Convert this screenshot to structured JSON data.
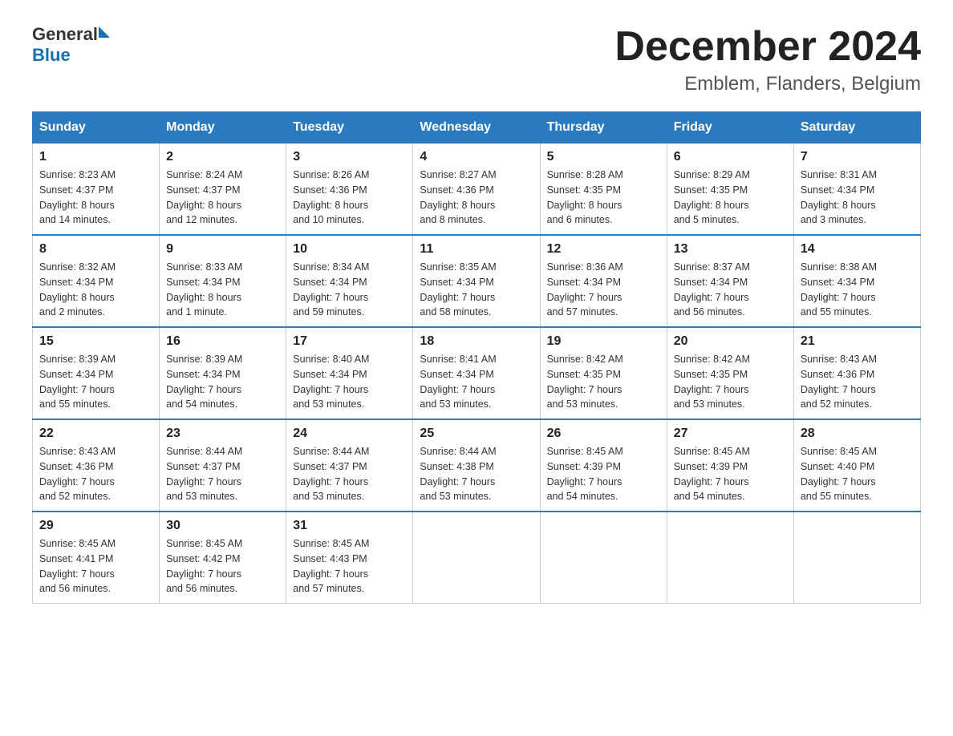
{
  "header": {
    "logo_text1": "General",
    "logo_text2": "Blue",
    "month_title": "December 2024",
    "location": "Emblem, Flanders, Belgium"
  },
  "days_of_week": [
    "Sunday",
    "Monday",
    "Tuesday",
    "Wednesday",
    "Thursday",
    "Friday",
    "Saturday"
  ],
  "weeks": [
    [
      {
        "day": "1",
        "info": "Sunrise: 8:23 AM\nSunset: 4:37 PM\nDaylight: 8 hours\nand 14 minutes."
      },
      {
        "day": "2",
        "info": "Sunrise: 8:24 AM\nSunset: 4:37 PM\nDaylight: 8 hours\nand 12 minutes."
      },
      {
        "day": "3",
        "info": "Sunrise: 8:26 AM\nSunset: 4:36 PM\nDaylight: 8 hours\nand 10 minutes."
      },
      {
        "day": "4",
        "info": "Sunrise: 8:27 AM\nSunset: 4:36 PM\nDaylight: 8 hours\nand 8 minutes."
      },
      {
        "day": "5",
        "info": "Sunrise: 8:28 AM\nSunset: 4:35 PM\nDaylight: 8 hours\nand 6 minutes."
      },
      {
        "day": "6",
        "info": "Sunrise: 8:29 AM\nSunset: 4:35 PM\nDaylight: 8 hours\nand 5 minutes."
      },
      {
        "day": "7",
        "info": "Sunrise: 8:31 AM\nSunset: 4:34 PM\nDaylight: 8 hours\nand 3 minutes."
      }
    ],
    [
      {
        "day": "8",
        "info": "Sunrise: 8:32 AM\nSunset: 4:34 PM\nDaylight: 8 hours\nand 2 minutes."
      },
      {
        "day": "9",
        "info": "Sunrise: 8:33 AM\nSunset: 4:34 PM\nDaylight: 8 hours\nand 1 minute."
      },
      {
        "day": "10",
        "info": "Sunrise: 8:34 AM\nSunset: 4:34 PM\nDaylight: 7 hours\nand 59 minutes."
      },
      {
        "day": "11",
        "info": "Sunrise: 8:35 AM\nSunset: 4:34 PM\nDaylight: 7 hours\nand 58 minutes."
      },
      {
        "day": "12",
        "info": "Sunrise: 8:36 AM\nSunset: 4:34 PM\nDaylight: 7 hours\nand 57 minutes."
      },
      {
        "day": "13",
        "info": "Sunrise: 8:37 AM\nSunset: 4:34 PM\nDaylight: 7 hours\nand 56 minutes."
      },
      {
        "day": "14",
        "info": "Sunrise: 8:38 AM\nSunset: 4:34 PM\nDaylight: 7 hours\nand 55 minutes."
      }
    ],
    [
      {
        "day": "15",
        "info": "Sunrise: 8:39 AM\nSunset: 4:34 PM\nDaylight: 7 hours\nand 55 minutes."
      },
      {
        "day": "16",
        "info": "Sunrise: 8:39 AM\nSunset: 4:34 PM\nDaylight: 7 hours\nand 54 minutes."
      },
      {
        "day": "17",
        "info": "Sunrise: 8:40 AM\nSunset: 4:34 PM\nDaylight: 7 hours\nand 53 minutes."
      },
      {
        "day": "18",
        "info": "Sunrise: 8:41 AM\nSunset: 4:34 PM\nDaylight: 7 hours\nand 53 minutes."
      },
      {
        "day": "19",
        "info": "Sunrise: 8:42 AM\nSunset: 4:35 PM\nDaylight: 7 hours\nand 53 minutes."
      },
      {
        "day": "20",
        "info": "Sunrise: 8:42 AM\nSunset: 4:35 PM\nDaylight: 7 hours\nand 53 minutes."
      },
      {
        "day": "21",
        "info": "Sunrise: 8:43 AM\nSunset: 4:36 PM\nDaylight: 7 hours\nand 52 minutes."
      }
    ],
    [
      {
        "day": "22",
        "info": "Sunrise: 8:43 AM\nSunset: 4:36 PM\nDaylight: 7 hours\nand 52 minutes."
      },
      {
        "day": "23",
        "info": "Sunrise: 8:44 AM\nSunset: 4:37 PM\nDaylight: 7 hours\nand 53 minutes."
      },
      {
        "day": "24",
        "info": "Sunrise: 8:44 AM\nSunset: 4:37 PM\nDaylight: 7 hours\nand 53 minutes."
      },
      {
        "day": "25",
        "info": "Sunrise: 8:44 AM\nSunset: 4:38 PM\nDaylight: 7 hours\nand 53 minutes."
      },
      {
        "day": "26",
        "info": "Sunrise: 8:45 AM\nSunset: 4:39 PM\nDaylight: 7 hours\nand 54 minutes."
      },
      {
        "day": "27",
        "info": "Sunrise: 8:45 AM\nSunset: 4:39 PM\nDaylight: 7 hours\nand 54 minutes."
      },
      {
        "day": "28",
        "info": "Sunrise: 8:45 AM\nSunset: 4:40 PM\nDaylight: 7 hours\nand 55 minutes."
      }
    ],
    [
      {
        "day": "29",
        "info": "Sunrise: 8:45 AM\nSunset: 4:41 PM\nDaylight: 7 hours\nand 56 minutes."
      },
      {
        "day": "30",
        "info": "Sunrise: 8:45 AM\nSunset: 4:42 PM\nDaylight: 7 hours\nand 56 minutes."
      },
      {
        "day": "31",
        "info": "Sunrise: 8:45 AM\nSunset: 4:43 PM\nDaylight: 7 hours\nand 57 minutes."
      },
      {
        "day": "",
        "info": ""
      },
      {
        "day": "",
        "info": ""
      },
      {
        "day": "",
        "info": ""
      },
      {
        "day": "",
        "info": ""
      }
    ]
  ]
}
